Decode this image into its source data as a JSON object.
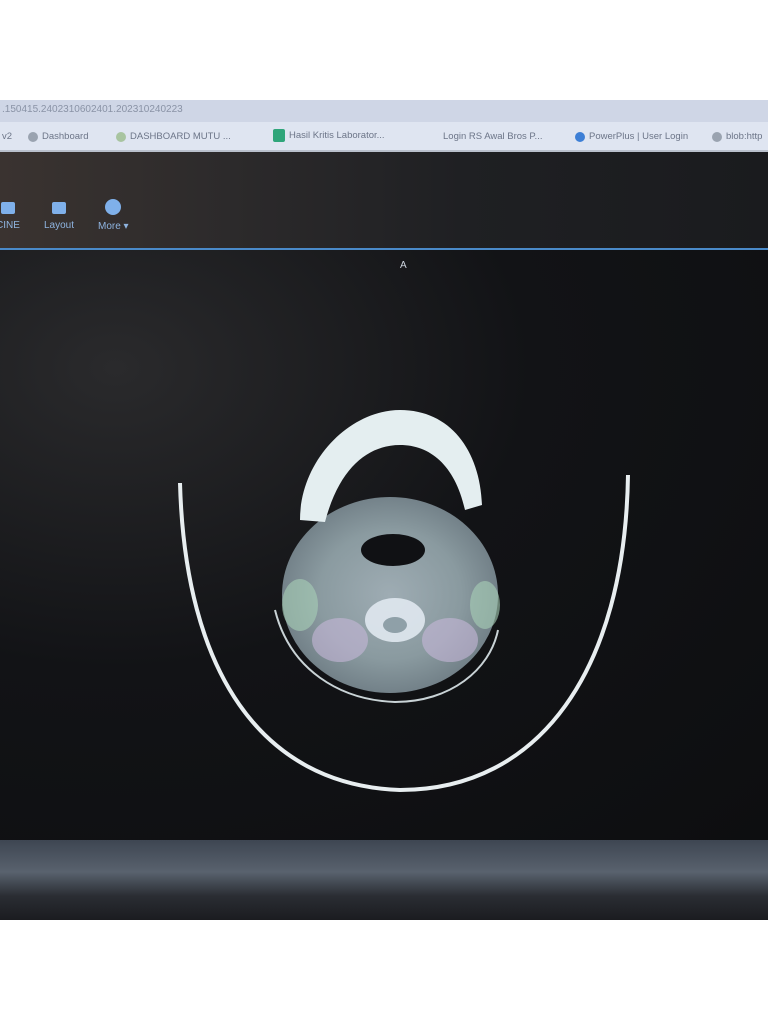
{
  "browser": {
    "address": ".150415.2402310602401.202310240223",
    "bookmarks": [
      {
        "label": "v2",
        "icon": "none"
      },
      {
        "label": "Dashboard",
        "icon": "gear-icon"
      },
      {
        "label": "DASHBOARD MUTU ...",
        "icon": "gear-icon"
      },
      {
        "label": "Hasil Kritis Laborator...",
        "icon": "sheets-icon"
      },
      {
        "label": "Login RS Awal Bros P...",
        "icon": "none"
      },
      {
        "label": "PowerPlus | User Login",
        "icon": "globe-icon"
      },
      {
        "label": "blob:http",
        "icon": "globe-icon"
      }
    ]
  },
  "toolbar": {
    "items": [
      {
        "label": "CINE",
        "icon": "camera-icon"
      },
      {
        "label": "Layout",
        "icon": "grid-icon"
      },
      {
        "label": "More ▾",
        "icon": "more-icon"
      }
    ]
  },
  "viewer": {
    "orientation_top": "A"
  }
}
